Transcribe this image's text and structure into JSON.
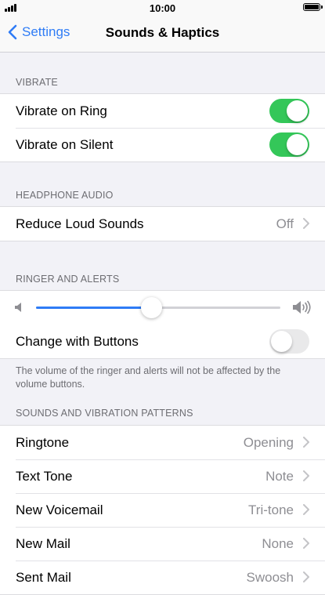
{
  "status_bar": {
    "time": "10:00"
  },
  "nav": {
    "back_label": "Settings",
    "title": "Sounds & Haptics"
  },
  "sections": {
    "vibrate": {
      "header": "VIBRATE",
      "rows": [
        {
          "label": "Vibrate on Ring",
          "toggle": "on"
        },
        {
          "label": "Vibrate on Silent",
          "toggle": "on"
        }
      ]
    },
    "headphone": {
      "header": "HEADPHONE AUDIO",
      "rows": [
        {
          "label": "Reduce Loud Sounds",
          "value": "Off"
        }
      ]
    },
    "ringer": {
      "header": "RINGER AND ALERTS",
      "volume_level": 0.47,
      "change_with_buttons_label": "Change with Buttons",
      "change_with_buttons": "off",
      "footer": "The volume of the ringer and alerts will not be affected by the volume buttons."
    },
    "sounds": {
      "header": "SOUNDS AND VIBRATION PATTERNS",
      "rows": [
        {
          "label": "Ringtone",
          "value": "Opening"
        },
        {
          "label": "Text Tone",
          "value": "Note"
        },
        {
          "label": "New Voicemail",
          "value": "Tri-tone"
        },
        {
          "label": "New Mail",
          "value": "None"
        },
        {
          "label": "Sent Mail",
          "value": "Swoosh"
        }
      ]
    }
  },
  "colors": {
    "accent": "#2f7cf6",
    "toggle_on": "#34c759",
    "toggle_off": "#e9e9ea"
  }
}
